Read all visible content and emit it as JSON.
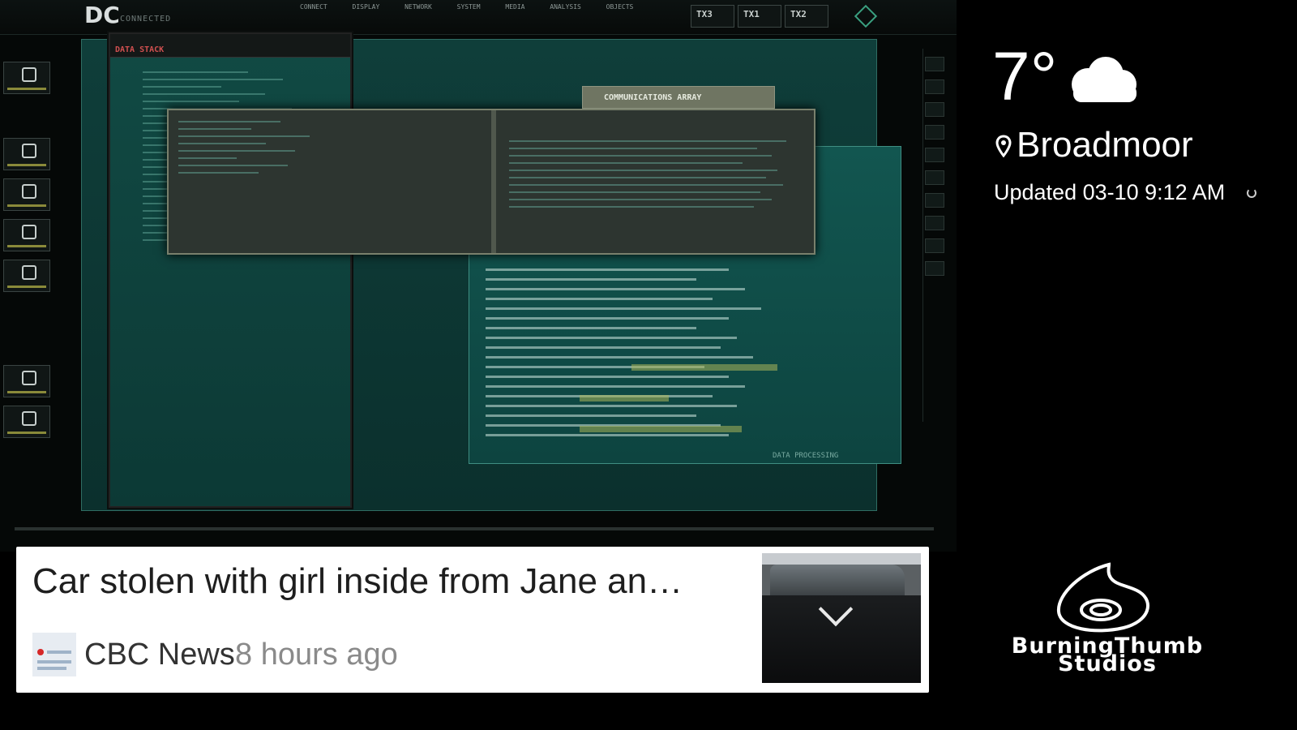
{
  "hud": {
    "logo": "DC",
    "status": "CONNECTED",
    "menu": [
      "CONNECT",
      "DISPLAY",
      "NETWORK",
      "SYSTEM",
      "MEDIA",
      "ANALYSIS",
      "OBJECTS"
    ],
    "tx_boxes": [
      "TX3",
      "TX1",
      "TX2"
    ],
    "data_stack_label": "DATA STACK",
    "comm_tab": "COMMUNICATIONS ARRAY",
    "data_processing": "DATA PROCESSING"
  },
  "news": {
    "headline": "Car stolen with girl inside from Jane an…",
    "source": "CBC News",
    "time": "8 hours ago"
  },
  "weather": {
    "temperature": "7°",
    "condition_icon": "cloud-icon",
    "location": "Broadmoor",
    "updated": "Updated 03-10 9:12 AM"
  },
  "brand": {
    "line1": "BurningThumb",
    "line2": "Studios"
  }
}
